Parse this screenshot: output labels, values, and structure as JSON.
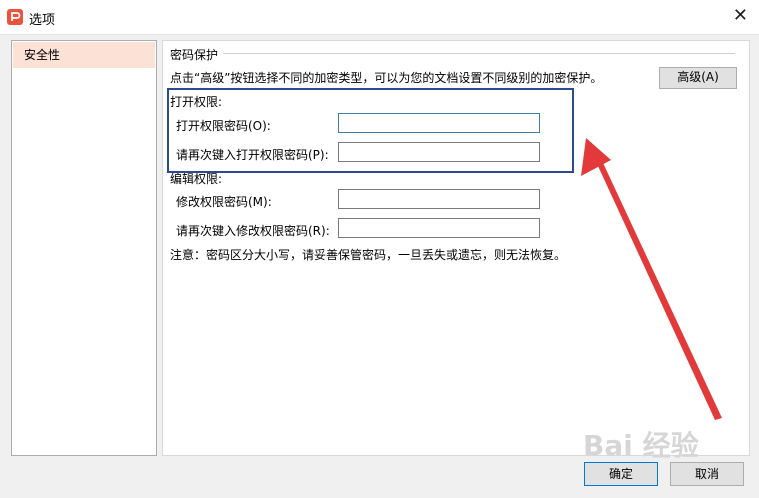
{
  "window": {
    "title": "选项",
    "close_glyph": "✕",
    "app_icon": "wps-presentation-icon"
  },
  "sidebar": {
    "items": [
      {
        "label": "安全性",
        "selected": true
      }
    ]
  },
  "password_protection": {
    "section_title": "密码保护",
    "description": "点击“高级”按钮选择不同的加密类型，可以为您的文档设置不同级别的加密保护。",
    "advanced_button": "高级(A)",
    "open_permission": {
      "title": "打开权限:",
      "password_label": "打开权限密码(O):",
      "password_value": "",
      "confirm_label": "请再次键入打开权限密码(P):",
      "confirm_value": ""
    },
    "edit_permission": {
      "title": "编辑权限:",
      "password_label": "修改权限密码(M):",
      "password_value": "",
      "confirm_label": "请再次键入修改权限密码(R):",
      "confirm_value": ""
    },
    "note": "注意：密码区分大小写，请妥善保管密码，一旦丢失或遗忘，则无法恢复。"
  },
  "footer": {
    "ok_label": "确定",
    "cancel_label": "取消"
  },
  "annotation": {
    "highlight_color": "#2b4a8f",
    "arrow_color": "#e23a3a"
  },
  "watermark": {
    "text": "Bai 经验"
  }
}
